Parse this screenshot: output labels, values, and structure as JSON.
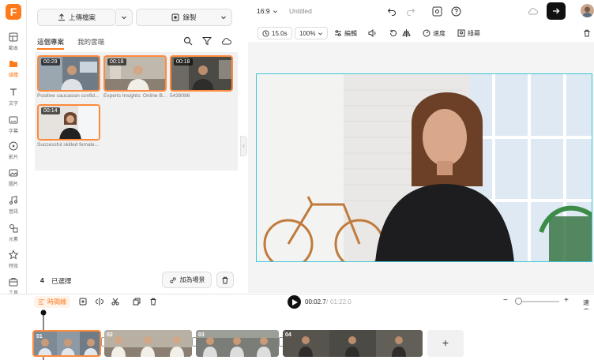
{
  "app": {
    "logo_letter": "F",
    "accent": "#ff7a1a"
  },
  "nav": [
    {
      "label": "範本",
      "icon": "template-icon"
    },
    {
      "label": "媒體",
      "icon": "media-icon",
      "active": true
    },
    {
      "label": "文字",
      "icon": "text-icon"
    },
    {
      "label": "字幕",
      "icon": "subtitle-icon"
    },
    {
      "label": "影片",
      "icon": "video-icon"
    },
    {
      "label": "圖片",
      "icon": "image-icon"
    },
    {
      "label": "音訊",
      "icon": "audio-icon"
    },
    {
      "label": "元素",
      "icon": "elements-icon"
    },
    {
      "label": "特效",
      "icon": "effects-icon"
    },
    {
      "label": "工具",
      "icon": "tools-icon"
    }
  ],
  "panel": {
    "upload_label": "上傳檔案",
    "record_label": "錄製",
    "tabs": [
      "這個專案",
      "我的雲端"
    ],
    "items": [
      {
        "duration": "00:29",
        "caption": "Positive caucasian confid..."
      },
      {
        "duration": "00:18",
        "caption": "Experts Insights: Online B..."
      },
      {
        "duration": "00:18",
        "caption": "5439086"
      },
      {
        "duration": "00:14",
        "caption": "Successful skilled female..."
      }
    ],
    "selected_count": "4",
    "selected_label": "已選擇",
    "add_scene_label": "加為場景"
  },
  "topbar": {
    "aspect": "16:9",
    "title": "Untitled"
  },
  "editbar": {
    "duration": "15.0s",
    "zoom": "100%",
    "edit_label": "編輯",
    "speed_label": "速度",
    "subtitle_label": "綠幕"
  },
  "timeline": {
    "timeline_label": "時間線",
    "current_time": "00:02.7",
    "total_time": "01:22.0",
    "more_label": "速度",
    "clips": [
      "01",
      "02",
      "03",
      "04"
    ]
  }
}
